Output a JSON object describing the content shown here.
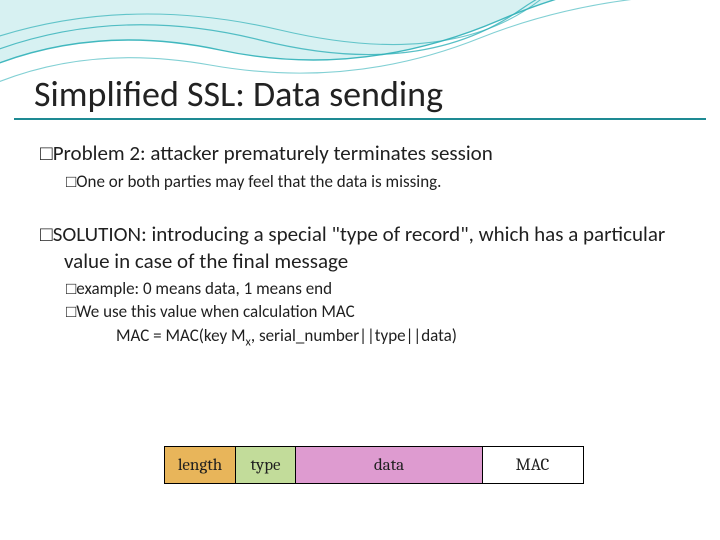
{
  "title": "Simplified SSL: Data sending",
  "body": {
    "problem_label": "Problem 2: attacker prematurely terminates session",
    "problem_sub": "One or both parties may feel that the data is missing.",
    "solution_label": "SOLUTION: introducing a special \"type of record\", which has a particular value in case of the final message",
    "example": "example: 0 means data, 1 means end",
    "mac_intro": "We use this value when calculation MAC",
    "mac_formula_prefix": "MAC = MAC(key M",
    "mac_formula_sub": "x",
    "mac_formula_suffix": ", serial_number||type||data)"
  },
  "bullet_glyph": "□",
  "record": {
    "length": "length",
    "type": "type",
    "data": "data",
    "mac": "MAC"
  }
}
